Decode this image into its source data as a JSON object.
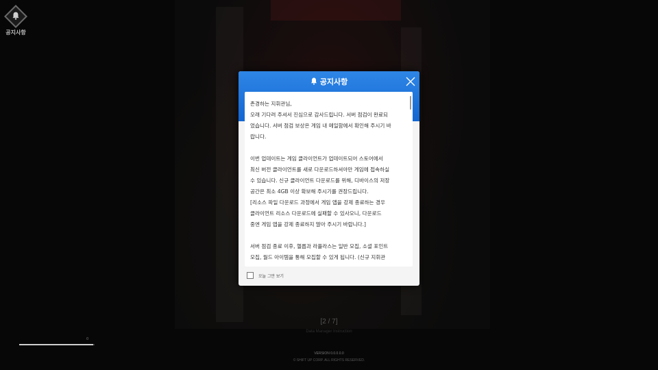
{
  "top_left": {
    "label": "공지사항",
    "icon": "bell-icon"
  },
  "dialog": {
    "title": "공지사항",
    "title_icon": "bell-icon",
    "close_icon": "close-icon",
    "paragraphs": [
      [
        "존경하는 지휘관님,",
        "오래 기다려 주셔서 진심으로 감사드립니다. 서버 점검이 완료되",
        "었습니다. 서버 점검 보상은 게임 내 메일함에서 확인해 주시기 바",
        "랍니다."
      ],
      [
        "이번 업데이트는 게임 클라이언트가 업데이트되어 스토어에서",
        "최신 버전 클라이언트를 새로 다운로드하셔야만 게임에 접속하실",
        "수 있습니다. 신규 클라이언트 다운로드를 위해, 디바이스의 저장",
        "공간은 최소 4GB 이상 확보해 주시기를 권장드립니다.",
        "[리소스 파일 다운로드 과정에서 게임 앱을 강제 종료하는 경우",
        "클라이언트 리소스 다운로드에 실패할 수 있사오니, 다운로드",
        "중엔 게임 앱을 강제 종료하지 말아 주시기 바랍니다.]"
      ],
      [
        "서버 점검 종료 이후, 헬릅과 라플라스는 일반 모집, 소셜 포인트",
        "모집, 월드 아이템을 통해 모집할 수 있게 됩니다. (신규 지휘관"
      ]
    ],
    "dont_show_today": "오늘 그만 보기",
    "accent_color": "#1a6fdc"
  },
  "page_indicator": "[2 / 7]",
  "page_subtitle": "Data Manager Instruction",
  "progress": {
    "fraction": 0.98,
    "label": "0"
  },
  "version": "VERSION  0.0.0.0.0",
  "copyright": "© SHIFT UP CORP. ALL RIGHTS RESERVED."
}
